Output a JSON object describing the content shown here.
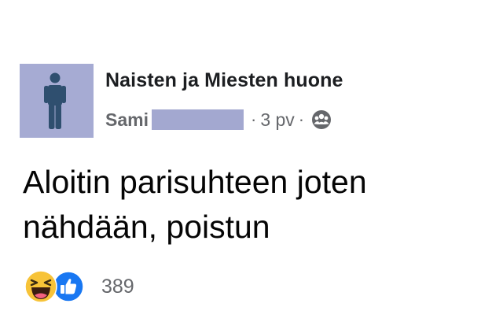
{
  "post": {
    "group_name": "Naisten ja Miesten huone",
    "author": "Sami",
    "separator": "·",
    "time": "3 pv",
    "privacy_icon": "group-privacy-icon",
    "body_lines": [
      "Aloitin parisuhteen joten",
      "nähdään, poistun"
    ],
    "reactions": {
      "icons": [
        "haha-reaction-icon",
        "like-reaction-icon"
      ],
      "count": "389"
    }
  },
  "colors": {
    "avatar_bg": "#a6abd3",
    "avatar_figure": "#2f4f6f",
    "redaction": "#a3a8d0",
    "meta_text": "#65676b",
    "like_blue": "#1877f2",
    "haha_yellow": "#f7c338"
  }
}
